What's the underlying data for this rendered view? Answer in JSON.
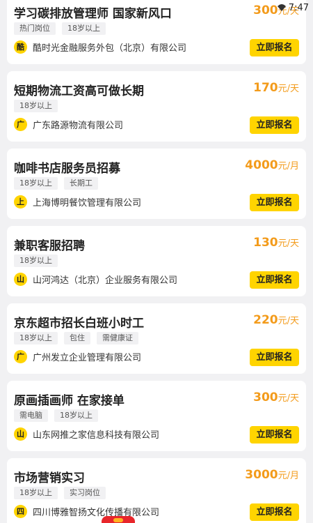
{
  "status_bar": {
    "time": "7:47"
  },
  "apply_label": "立即报名",
  "jobs": [
    {
      "title": "学习碳排放管理师 国家新风口",
      "salary": "300",
      "unit": "元/天",
      "tags": [
        "热门岗位",
        "18岁以上"
      ],
      "badge": "酷",
      "company": "酷时光金融服务外包（北京）有限公司"
    },
    {
      "title": "短期物流工资高可做长期",
      "salary": "170",
      "unit": "元/天",
      "tags": [
        "18岁以上"
      ],
      "badge": "广",
      "company": "广东路源物流有限公司"
    },
    {
      "title": "咖啡书店服务员招募",
      "salary": "4000",
      "unit": "元/月",
      "tags": [
        "18岁以上",
        "长期工"
      ],
      "badge": "上",
      "company": "上海博明餐饮管理有限公司"
    },
    {
      "title": "兼职客服招聘",
      "salary": "130",
      "unit": "元/天",
      "tags": [
        "18岁以上"
      ],
      "badge": "山",
      "company": "山河鸿达（北京）企业服务有限公司"
    },
    {
      "title": "京东超市招长白班小时工",
      "salary": "220",
      "unit": "元/天",
      "tags": [
        "18岁以上",
        "包住",
        "需健康证"
      ],
      "badge": "广",
      "company": "广州发立企业管理有限公司"
    },
    {
      "title": "原画插画师 在家接单",
      "salary": "300",
      "unit": "元/天",
      "tags": [
        "需电脑",
        "18岁以上"
      ],
      "badge": "山",
      "company": "山东网推之家信息科技有限公司"
    },
    {
      "title": "市场营销实习",
      "salary": "3000",
      "unit": "元/月",
      "tags": [
        "18岁以上",
        "实习岗位"
      ],
      "badge": "四",
      "company": "四川博雅智扬文化传播有限公司"
    }
  ]
}
